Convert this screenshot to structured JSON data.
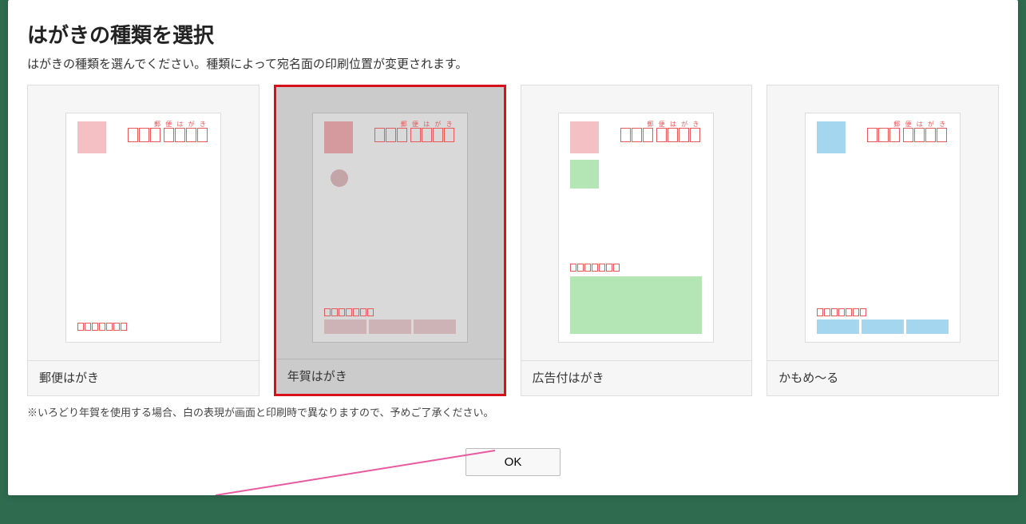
{
  "dialog": {
    "title": "はがきの種類を選択",
    "subtitle": "はがきの種類を選んでください。種類によって宛名面の印刷位置が変更されます。",
    "options": [
      {
        "label": "郵便はがき",
        "selected": false,
        "type": "normal"
      },
      {
        "label": "年賀はがき",
        "selected": true,
        "type": "nengajo"
      },
      {
        "label": "広告付はがき",
        "selected": false,
        "type": "ad"
      },
      {
        "label": "かもめ〜る",
        "selected": false,
        "type": "kamome"
      }
    ],
    "notice": "※いろどり年賀を使用する場合、白の表現が画面と印刷時で異なりますので、予めご了承ください。",
    "ok_label": "OK",
    "header_small_text": "郵 便 は が き"
  },
  "colors": {
    "selected_border": "#d8101c",
    "postal_red": "#e85a5a",
    "pink": "#f4c0c3",
    "green": "#b4e5b4",
    "blue": "#a5d6ef",
    "annotation": "#e85a9f"
  }
}
